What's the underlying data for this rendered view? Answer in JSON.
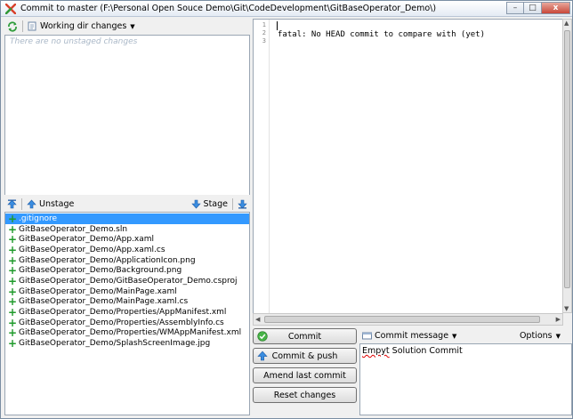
{
  "window": {
    "title": "Commit to master (F:\\Personal Open Souce Demo\\Git\\CodeDevelopment\\GitBaseOperator_Demo\\)",
    "minimize": "–",
    "maximize": "□",
    "close": "x"
  },
  "unstaged": {
    "dropdown_label": "Working dir changes",
    "empty_text": "There are no unstaged changes"
  },
  "stage_toolbar": {
    "unstage_label": "Unstage",
    "stage_label": "Stage"
  },
  "staged": {
    "files": [
      ".gitignore",
      "GitBaseOperator_Demo.sln",
      "GitBaseOperator_Demo/App.xaml",
      "GitBaseOperator_Demo/App.xaml.cs",
      "GitBaseOperator_Demo/ApplicationIcon.png",
      "GitBaseOperator_Demo/Background.png",
      "GitBaseOperator_Demo/GitBaseOperator_Demo.csproj",
      "GitBaseOperator_Demo/MainPage.xaml",
      "GitBaseOperator_Demo/MainPage.xaml.cs",
      "GitBaseOperator_Demo/Properties/AppManifest.xml",
      "GitBaseOperator_Demo/Properties/AssemblyInfo.cs",
      "GitBaseOperator_Demo/Properties/WMAppManifest.xml",
      "GitBaseOperator_Demo/SplashScreenImage.jpg"
    ],
    "selected_index": 0
  },
  "diff": {
    "line_numbers": [
      "1",
      "2",
      "3"
    ],
    "text": "fatal: No HEAD commit to compare with (yet)"
  },
  "actions": {
    "commit": "Commit",
    "commit_push": "Commit & push",
    "amend": "Amend last commit",
    "reset": "Reset changes"
  },
  "message": {
    "dropdown_label": "Commit message",
    "options_label": "Options",
    "word1": "Empyt",
    "rest": " Solution Commit"
  },
  "icons": {
    "app": "git-extensions-icon",
    "refresh": "refresh-icon",
    "stage": "stage-arrow-down-icon",
    "unstage": "unstage-arrow-up-icon",
    "commit": "check-icon"
  },
  "colors": {
    "selection": "#3399ff",
    "added": "#1e9a2a",
    "accent": "#3a8de0"
  }
}
